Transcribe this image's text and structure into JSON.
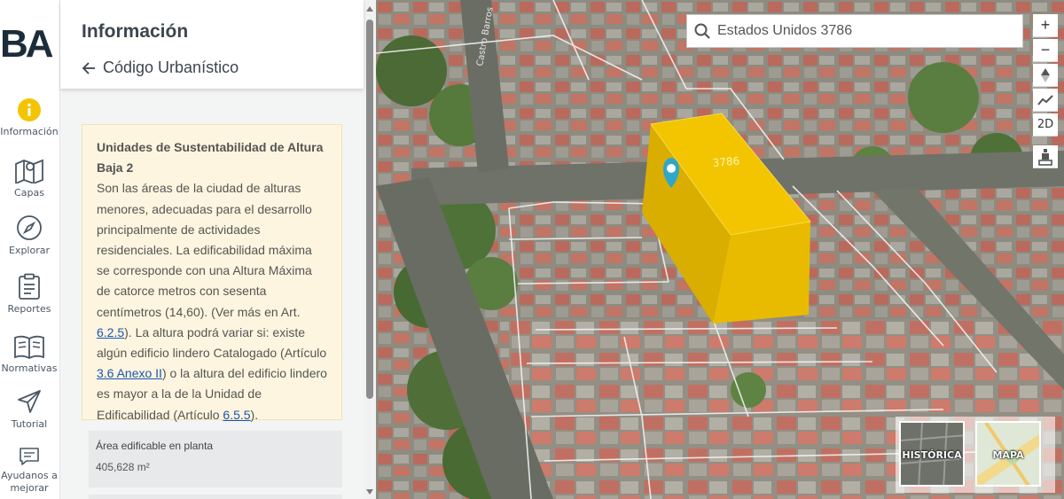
{
  "brand": {
    "logo_text": "BA",
    "logo_color": "#1c2c3a"
  },
  "rail": {
    "items": [
      {
        "label": "Información",
        "icon": "info-icon",
        "active": true
      },
      {
        "label": "Capas",
        "icon": "map-layers-icon"
      },
      {
        "label": "Explorar",
        "icon": "compass-icon"
      },
      {
        "label": "Reportes",
        "icon": "clipboard-icon"
      },
      {
        "label": "Normativas",
        "icon": "book-icon"
      },
      {
        "label": "Tutorial",
        "icon": "paper-plane-icon"
      },
      {
        "label": "Ayudanos a mejorar",
        "icon": "chat-icon"
      }
    ]
  },
  "panel": {
    "title": "Información",
    "back_label": "Código Urbanístico",
    "info": {
      "heading": "Unidades de Sustentabilidad de Altura Baja 2",
      "text_1": "Son las áreas de la ciudad de alturas menores, adecuadas para el desarrollo principalmente de actividades residenciales. La edificabilidad máxima se corresponde con una Altura Máxima de catorce metros con sesenta centímetros (14,60). (Ver más en Art. ",
      "link_1": "6.2.5",
      "text_2": "). La altura podrá variar si: existe algún edificio lindero Catalogado (Artículo ",
      "link_2": "3.6 Anexo II",
      "text_3": ") o la altura del edificio lindero es mayor a la de la Unidad de Edificabilidad (Artículo ",
      "link_3": "6.5.5",
      "text_4": ")."
    },
    "stat": {
      "label": "Área edificable en planta",
      "value": "405,628 m²"
    }
  },
  "map": {
    "search_value": "Estados Unidos 3786",
    "street_label": "Castro Barros",
    "lot_label": "3786",
    "controls": {
      "zoom_in": "+",
      "zoom_out": "−",
      "view_2d": "2D"
    },
    "basemaps": [
      {
        "label": "HISTÓRICA"
      },
      {
        "label": "MAPA"
      }
    ],
    "accent_color": "#f2c500",
    "marker_color": "#2ea7c8"
  }
}
